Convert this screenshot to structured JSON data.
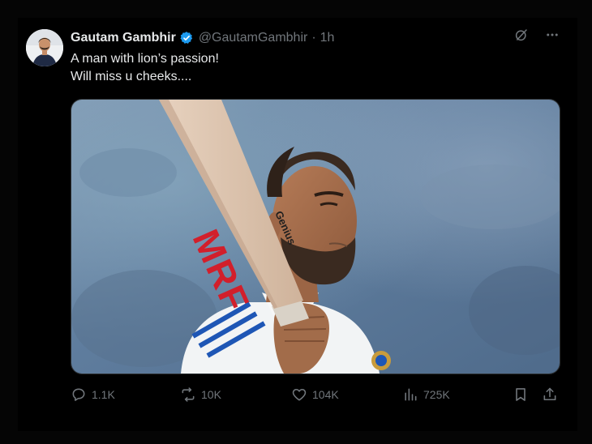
{
  "tweet": {
    "author_name": "Gautam Gambhir",
    "handle": "@GautamGambhir",
    "separator": "·",
    "time": "1h",
    "text_lines": [
      "A man with lion’s passion!",
      "Will miss u cheeks...."
    ],
    "bat_brand": "MRF",
    "bat_label": "Genius"
  },
  "actions": {
    "replies": "1.1K",
    "reposts": "10K",
    "likes": "104K",
    "views": "725K"
  },
  "icons": {
    "verified": "verified-badge-icon",
    "grok": "grok-icon",
    "more": "more-icon",
    "reply": "reply-icon",
    "repost": "repost-icon",
    "like": "like-icon",
    "views": "views-icon",
    "bookmark": "bookmark-icon",
    "share": "share-icon"
  },
  "colors": {
    "background": "#000000",
    "text_primary": "#e7e9ea",
    "text_secondary": "#71767b",
    "verified": "#1d9bf0"
  }
}
